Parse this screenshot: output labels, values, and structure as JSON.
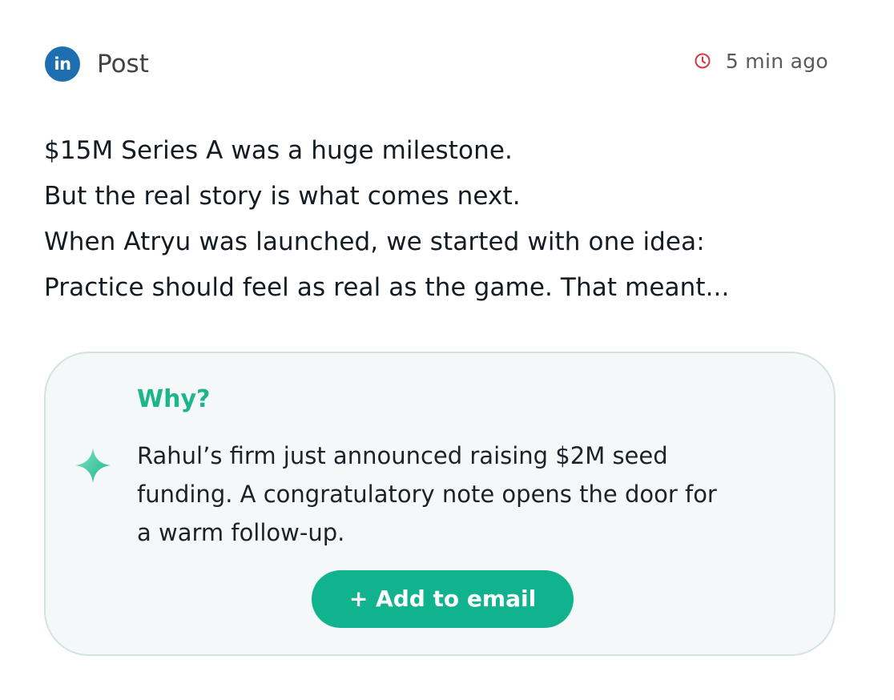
{
  "header": {
    "network_icon_text": "in",
    "network_icon": "linkedin-icon",
    "type_label": "Post",
    "time_icon": "clock-icon",
    "time_text": "5 min ago"
  },
  "post": {
    "lines": [
      "$15M Series A was a huge milestone.",
      "But the real story is what comes next.",
      "When Atryu was launched, we started with one idea:",
      "Practice should feel as real as the game. That meant..."
    ]
  },
  "why": {
    "icon": "sparkle-icon",
    "title": "Why?",
    "lines": [
      "Rahul’s firm just announced raising $2M seed",
      "funding. A congratulatory note opens the door for",
      "a warm follow-up."
    ],
    "button_label": "+ Add to email"
  },
  "colors": {
    "linkedin_blue": "#1d6fb0",
    "clock_red": "#d9363e",
    "accent_green": "#10b38d",
    "card_background": "#f4f8f8",
    "card_border": "#d4e3e2"
  }
}
